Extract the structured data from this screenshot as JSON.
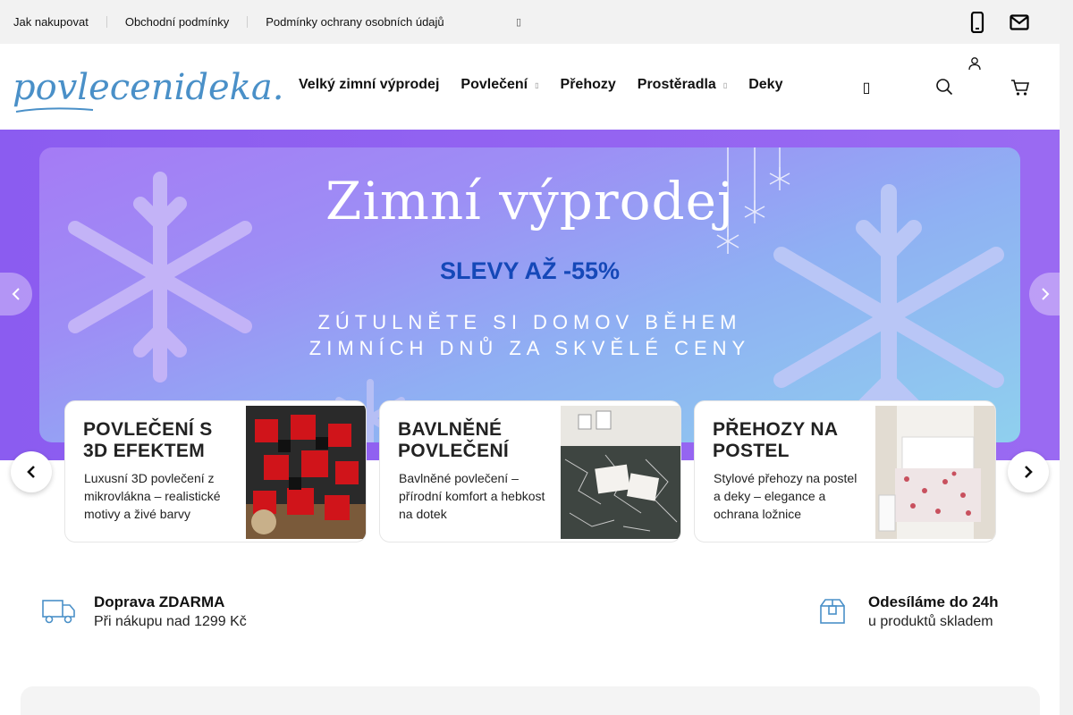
{
  "topbar": {
    "links": [
      "Jak nakupovat",
      "Obchodní podmínky",
      "Podmínky ochrany osobních údajů"
    ],
    "more_icon": "chevron-down-icon",
    "phone_icon": "phone-icon",
    "mail_icon": "mail-icon"
  },
  "header": {
    "logo_text": "povlecenideka.cz",
    "nav": [
      {
        "label": "Velký zimní výprodej",
        "has_dropdown": false
      },
      {
        "label": "Povlečení",
        "has_dropdown": true
      },
      {
        "label": "Přehozy",
        "has_dropdown": false
      },
      {
        "label": "Prostěradla",
        "has_dropdown": true
      },
      {
        "label": "Deky",
        "has_dropdown": false
      }
    ],
    "icons": [
      "hamburger-icon",
      "search-icon",
      "user-icon",
      "cart-icon"
    ]
  },
  "hero": {
    "title": "Zimní výprodej",
    "discount": "SLEVY AŽ -55%",
    "tagline": "ZÚTULNĚTE SI DOMOV BĚHEM ZIMNÍCH DNŮ ZA SKVĚLÉ CENY"
  },
  "cards": [
    {
      "title": "POVLEČENÍ S 3D EFEKTEM",
      "desc": "Luxusní 3D povlečení z mikrovlákna – realistické motivy a živé barvy"
    },
    {
      "title": "BAVLNĚNÉ POVLEČENÍ",
      "desc": "Bavlněné povlečení – přírodní komfort a hebkost na dotek"
    },
    {
      "title": "PŘEHOZY NA POSTEL",
      "desc": "Stylové přehozy na postel a deky – elegance a ochrana ložnice"
    }
  ],
  "info": [
    {
      "title": "Doprava ZDARMA",
      "sub": "Při nákupu nad 1299 Kč",
      "icon": "truck-icon"
    },
    {
      "title": "Odesíláme do 24h",
      "sub": "u produktů skladem",
      "icon": "box-icon"
    }
  ],
  "colors": {
    "accent": "#4a90c8",
    "hero_bg": "#8b5cf0",
    "discount": "#1548b8"
  }
}
